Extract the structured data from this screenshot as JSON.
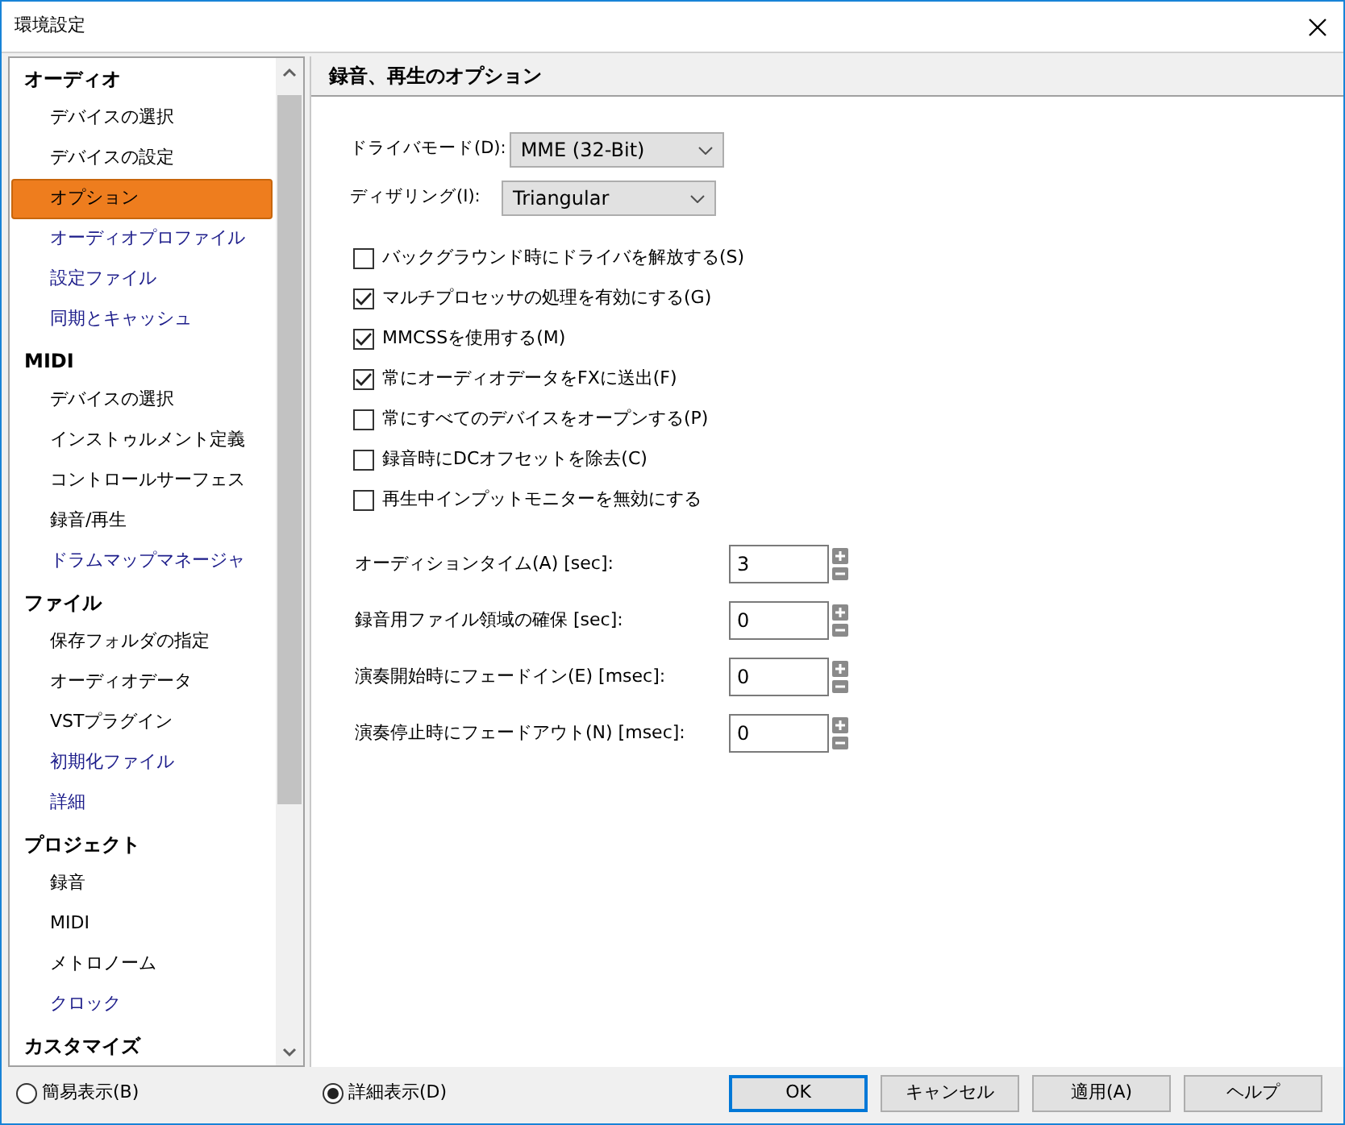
{
  "window": {
    "title": "環境設定"
  },
  "sidebar": {
    "items": [
      {
        "label": "オーディオ",
        "kind": "category"
      },
      {
        "label": "デバイスの選択",
        "kind": "item",
        "selected": false,
        "color": "#000000"
      },
      {
        "label": "デバイスの設定",
        "kind": "item",
        "selected": false,
        "color": "#000000"
      },
      {
        "label": "オプション",
        "kind": "item",
        "selected": true
      },
      {
        "label": "オーディオプロファイル",
        "kind": "item",
        "selected": false,
        "color": "#1c1c8a"
      },
      {
        "label": "設定ファイル",
        "kind": "item",
        "selected": false,
        "color": "#1c1c8a"
      },
      {
        "label": "同期とキャッシュ",
        "kind": "item",
        "selected": false,
        "color": "#1c1c8a"
      },
      {
        "label": "MIDI",
        "kind": "category"
      },
      {
        "label": "デバイスの選択",
        "kind": "item",
        "selected": false,
        "color": "#000000"
      },
      {
        "label": "インストゥルメント定義",
        "kind": "item",
        "selected": false,
        "color": "#000000"
      },
      {
        "label": "コントロールサーフェス",
        "kind": "item",
        "selected": false,
        "color": "#000000"
      },
      {
        "label": "録音/再生",
        "kind": "item",
        "selected": false,
        "color": "#000000"
      },
      {
        "label": "ドラムマップマネージャ",
        "kind": "item",
        "selected": false,
        "color": "#1c1c8a"
      },
      {
        "label": "ファイル",
        "kind": "category"
      },
      {
        "label": "保存フォルダの指定",
        "kind": "item",
        "selected": false,
        "color": "#000000"
      },
      {
        "label": "オーディオデータ",
        "kind": "item",
        "selected": false,
        "color": "#000000"
      },
      {
        "label": "VSTプラグイン",
        "kind": "item",
        "selected": false,
        "color": "#000000"
      },
      {
        "label": "初期化ファイル",
        "kind": "item",
        "selected": false,
        "color": "#1c1c8a"
      },
      {
        "label": "詳細",
        "kind": "item",
        "selected": false,
        "color": "#1c1c8a"
      },
      {
        "label": "プロジェクト",
        "kind": "category"
      },
      {
        "label": "録音",
        "kind": "item",
        "selected": false,
        "color": "#000000"
      },
      {
        "label": "MIDI",
        "kind": "item",
        "selected": false,
        "color": "#000000"
      },
      {
        "label": "メトロノーム",
        "kind": "item",
        "selected": false,
        "color": "#000000"
      },
      {
        "label": "クロック",
        "kind": "item",
        "selected": false,
        "color": "#1c1c8a"
      },
      {
        "label": "カスタマイズ",
        "kind": "category"
      }
    ]
  },
  "panel": {
    "title": "録音、再生のオプション",
    "dropdowns": [
      {
        "label": "ドライバモード(D):",
        "value": "MME (32-Bit)"
      },
      {
        "label": "ディザリング(I):",
        "value": "Triangular"
      }
    ],
    "checkboxes": [
      {
        "label": "バックグラウンド時にドライバを解放する(S)",
        "checked": false
      },
      {
        "label": "マルチプロセッサの処理を有効にする(G)",
        "checked": true
      },
      {
        "label": "MMCSSを使用する(M)",
        "checked": true
      },
      {
        "label": "常にオーディオデータをFXに送出(F)",
        "checked": true
      },
      {
        "label": "常にすべてのデバイスをオープンする(P)",
        "checked": false
      },
      {
        "label": "録音時にDCオフセットを除去(C)",
        "checked": false
      },
      {
        "label": "再生中インプットモニターを無効にする",
        "checked": false
      }
    ],
    "spinners": [
      {
        "label": "オーディションタイム(A) [sec]:",
        "value": "3"
      },
      {
        "label": "録音用ファイル領域の確保 [sec]:",
        "value": "0"
      },
      {
        "label": "演奏開始時にフェードイン(E) [msec]:",
        "value": "0"
      },
      {
        "label": "演奏停止時にフェードアウト(N) [msec]:",
        "value": "0"
      }
    ]
  },
  "footer": {
    "view_modes": [
      {
        "label": "簡易表示(B)",
        "selected": false
      },
      {
        "label": "詳細表示(D)",
        "selected": true
      }
    ],
    "buttons": [
      {
        "label": "OK",
        "default": true
      },
      {
        "label": "キャンセル",
        "default": false
      },
      {
        "label": "適用(A)",
        "default": false
      },
      {
        "label": "ヘルプ",
        "default": false
      }
    ]
  }
}
